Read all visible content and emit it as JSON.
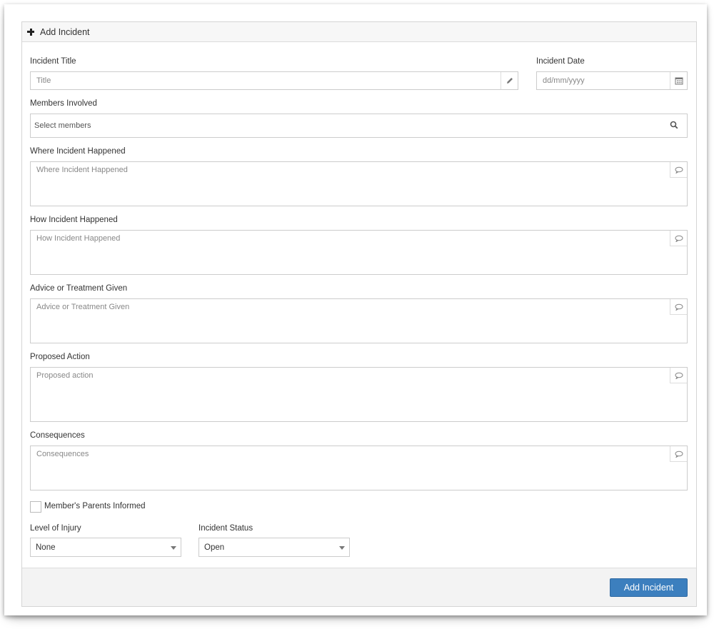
{
  "header": {
    "title": "Add Incident",
    "icon": "plus-icon"
  },
  "incident_title": {
    "label": "Incident Title",
    "placeholder": "Title",
    "icon": "pencil-icon"
  },
  "incident_date": {
    "label": "Incident Date",
    "placeholder": "dd/mm/yyyy",
    "icon": "calendar-icon"
  },
  "members": {
    "label": "Members Involved",
    "placeholder": "Select members",
    "icon": "search-icon"
  },
  "where": {
    "label": "Where Incident Happened",
    "placeholder": "Where Incident Happened",
    "icon": "comment-icon"
  },
  "how": {
    "label": "How Incident Happened",
    "placeholder": "How Incident Happened",
    "icon": "comment-icon"
  },
  "advice": {
    "label": "Advice or Treatment Given",
    "placeholder": "Advice or Treatment Given",
    "icon": "comment-icon"
  },
  "proposed": {
    "label": "Proposed Action",
    "placeholder": "Proposed action",
    "icon": "comment-icon"
  },
  "consequences": {
    "label": "Consequences",
    "placeholder": "Consequences",
    "icon": "comment-icon"
  },
  "parents_informed": {
    "label": "Member's Parents Informed",
    "checked": false
  },
  "injury": {
    "label": "Level of Injury",
    "value": "None"
  },
  "status": {
    "label": "Incident Status",
    "value": "Open"
  },
  "footer": {
    "submit_label": "Add Incident"
  },
  "colors": {
    "accent": "#3c7fbe",
    "border": "#cccccc",
    "footer_bg": "#f3f3f3"
  }
}
